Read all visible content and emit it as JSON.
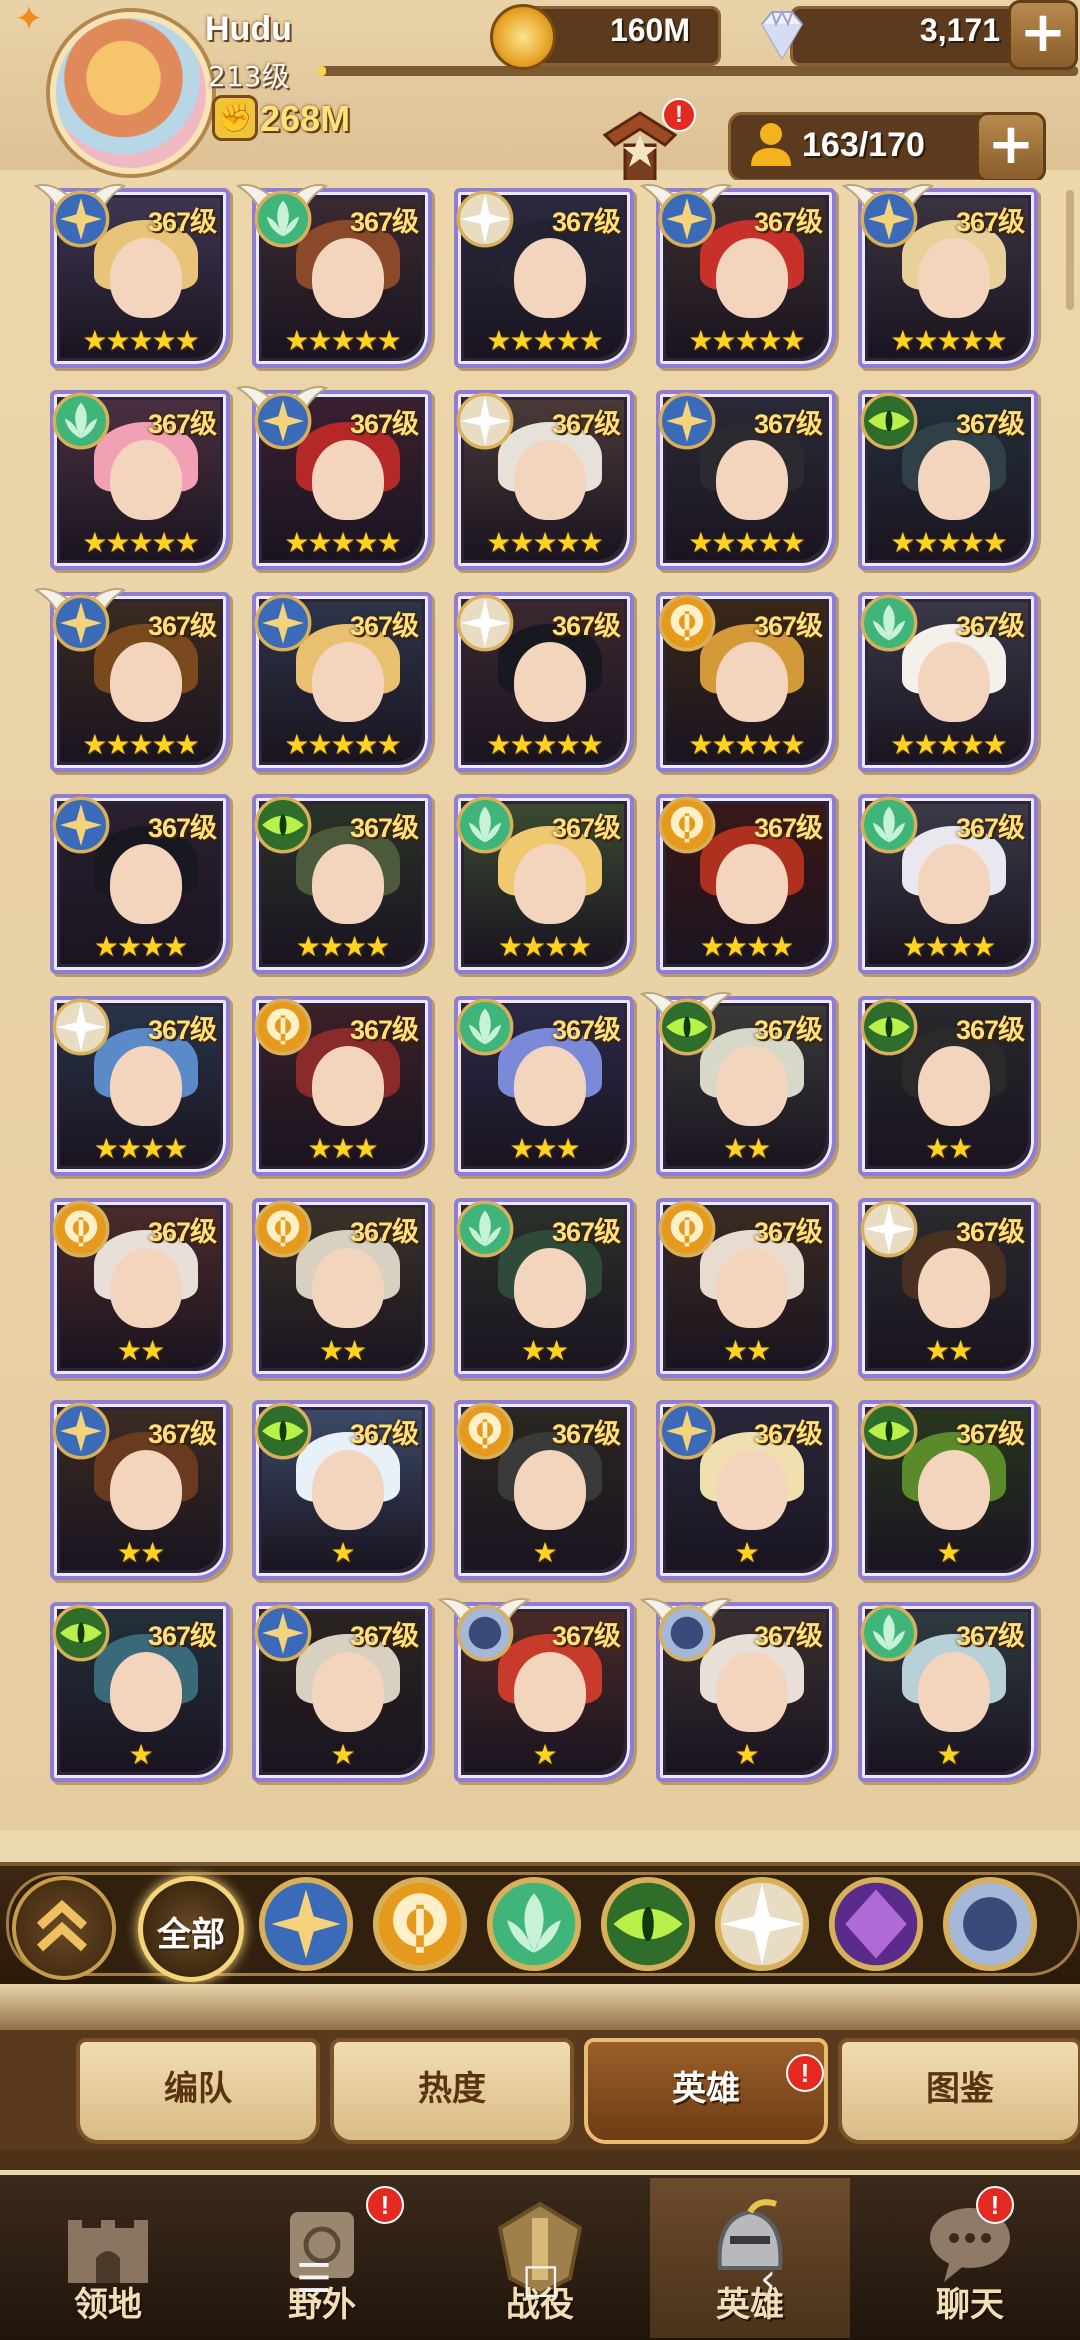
{
  "player": {
    "name": "Hudu",
    "level": "213级",
    "xp_fraction": 0.01,
    "power": "268M"
  },
  "resources": {
    "gold": "160M",
    "gems": "3,171",
    "roster": "163/170"
  },
  "heroes": [
    {
      "level": "367级",
      "stars": "★★★★★",
      "faction": "lightbearer",
      "wings": true,
      "hair": "#e8c47a",
      "bg": "#3e3550"
    },
    {
      "level": "367级",
      "stars": "★★★★★",
      "faction": "wilder",
      "wings": true,
      "hair": "#8a4a2a",
      "bg": "#3a2a30"
    },
    {
      "level": "367级",
      "stars": "★★★★★",
      "faction": "celestial",
      "wings": false,
      "hair": "#222233",
      "bg": "#2a2a3c"
    },
    {
      "level": "367级",
      "stars": "★★★★★",
      "faction": "lightbearer",
      "wings": true,
      "hair": "#c8312a",
      "bg": "#3b2e2e"
    },
    {
      "level": "367级",
      "stars": "★★★★★",
      "faction": "lightbearer",
      "wings": true,
      "hair": "#e8d09a",
      "bg": "#3a3340"
    },
    {
      "level": "367级",
      "stars": "★★★★★",
      "faction": "wilder",
      "wings": false,
      "hair": "#f2a0b4",
      "bg": "#4a3040"
    },
    {
      "level": "367级",
      "stars": "★★★★★",
      "faction": "lightbearer",
      "wings": true,
      "hair": "#b42828",
      "bg": "#3a2030"
    },
    {
      "level": "367级",
      "stars": "★★★★★",
      "faction": "celestial",
      "wings": false,
      "hair": "#e6e2da",
      "bg": "#4a3a38"
    },
    {
      "level": "367级",
      "stars": "★★★★★",
      "faction": "lightbearer",
      "wings": false,
      "hair": "#2a2a30",
      "bg": "#2a2a36"
    },
    {
      "level": "367级",
      "stars": "★★★★★",
      "faction": "graveborn",
      "wings": false,
      "hair": "#304048",
      "bg": "#22303a"
    },
    {
      "level": "367级",
      "stars": "★★★★★",
      "faction": "lightbearer",
      "wings": true,
      "hair": "#7a4a1e",
      "bg": "#3a2a20"
    },
    {
      "level": "367级",
      "stars": "★★★★★",
      "faction": "lightbearer",
      "wings": false,
      "hair": "#e8c070",
      "bg": "#2c3548"
    },
    {
      "level": "367级",
      "stars": "★★★★★",
      "faction": "celestial",
      "wings": false,
      "hair": "#181820",
      "bg": "#3a2830"
    },
    {
      "level": "367级",
      "stars": "★★★★★",
      "faction": "mauler",
      "wings": false,
      "hair": "#d49a3a",
      "bg": "#3a2818"
    },
    {
      "level": "367级",
      "stars": "★★★★★",
      "faction": "wilder",
      "wings": false,
      "hair": "#f4f0ea",
      "bg": "#3a3848"
    },
    {
      "level": "367级",
      "stars": "★★★★",
      "faction": "lightbearer",
      "wings": false,
      "hair": "#181820",
      "bg": "#2a2030"
    },
    {
      "level": "367级",
      "stars": "★★★★",
      "faction": "graveborn",
      "wings": false,
      "hair": "#4a5a3a",
      "bg": "#2a3228"
    },
    {
      "level": "367级",
      "stars": "★★★★",
      "faction": "wilder",
      "wings": false,
      "hair": "#f0c870",
      "bg": "#3a4a30"
    },
    {
      "level": "367级",
      "stars": "★★★★",
      "faction": "mauler",
      "wings": false,
      "hair": "#b03020",
      "bg": "#3a1818"
    },
    {
      "level": "367级",
      "stars": "★★★★",
      "faction": "wilder",
      "wings": false,
      "hair": "#e8e8ee",
      "bg": "#3a3a48"
    },
    {
      "level": "367级",
      "stars": "★★★★",
      "faction": "celestial",
      "wings": false,
      "hair": "#5a8ac8",
      "bg": "#283448"
    },
    {
      "level": "367级",
      "stars": "★★★",
      "faction": "mauler",
      "wings": false,
      "hair": "#8a2a2a",
      "bg": "#3a2028"
    },
    {
      "level": "367级",
      "stars": "★★★",
      "faction": "wilder",
      "wings": false,
      "hair": "#7a8ad8",
      "bg": "#2a2a48"
    },
    {
      "level": "367级",
      "stars": "★★",
      "faction": "graveborn",
      "wings": true,
      "hair": "#d8d8c8",
      "bg": "#3a3a38"
    },
    {
      "level": "367级",
      "stars": "★★",
      "faction": "graveborn",
      "wings": false,
      "hair": "#2a2a2a",
      "bg": "#28282c"
    },
    {
      "level": "367级",
      "stars": "★★",
      "faction": "mauler",
      "wings": false,
      "hair": "#e8e0d8",
      "bg": "#4a2a2a"
    },
    {
      "level": "367级",
      "stars": "★★",
      "faction": "mauler",
      "wings": false,
      "hair": "#d8d0c0",
      "bg": "#3a3228"
    },
    {
      "level": "367级",
      "stars": "★★",
      "faction": "wilder",
      "wings": false,
      "hair": "#304a3a",
      "bg": "#2a3028"
    },
    {
      "level": "367级",
      "stars": "★★",
      "faction": "mauler",
      "wings": false,
      "hair": "#e8dcd0",
      "bg": "#3a2a22"
    },
    {
      "level": "367级",
      "stars": "★★",
      "faction": "celestial",
      "wings": false,
      "hair": "#4a3020",
      "bg": "#2a2a2e"
    },
    {
      "level": "367级",
      "stars": "★★",
      "faction": "lightbearer",
      "wings": false,
      "hair": "#6a3a20",
      "bg": "#3a2a22"
    },
    {
      "level": "367级",
      "stars": "★",
      "faction": "graveborn",
      "wings": false,
      "hair": "#e8f0f8",
      "bg": "#3a4a68"
    },
    {
      "level": "367级",
      "stars": "★",
      "faction": "mauler",
      "wings": false,
      "hair": "#3a3a3a",
      "bg": "#2a2620"
    },
    {
      "level": "367级",
      "stars": "★",
      "faction": "lightbearer",
      "wings": false,
      "hair": "#f0e0b0",
      "bg": "#28283a"
    },
    {
      "level": "367级",
      "stars": "★",
      "faction": "graveborn",
      "wings": false,
      "hair": "#5a8a2a",
      "bg": "#28361e"
    },
    {
      "level": "367级",
      "stars": "★",
      "faction": "graveborn",
      "wings": false,
      "hair": "#3a6a7a",
      "bg": "#22303a"
    },
    {
      "level": "367级",
      "stars": "★",
      "faction": "lightbearer",
      "wings": false,
      "hair": "#d8d0c0",
      "bg": "#2a2420"
    },
    {
      "level": "367级",
      "stars": "★",
      "faction": "dimensional",
      "wings": true,
      "hair": "#c83a2a",
      "bg": "#4a2a28"
    },
    {
      "level": "367级",
      "stars": "★",
      "faction": "dimensional",
      "wings": true,
      "hair": "#e8e0d8",
      "bg": "#3a3030"
    },
    {
      "level": "367级",
      "stars": "★",
      "faction": "wilder",
      "wings": false,
      "hair": "#b8d0d8",
      "bg": "#2e3a40"
    }
  ],
  "faction_filters": [
    "lightbearer",
    "mauler",
    "wilder",
    "graveborn",
    "celestial",
    "hypogean",
    "dimensional"
  ],
  "faction_colors": {
    "lightbearer": "#3b6bb8",
    "mauler": "#e59a1e",
    "wilder": "#3fb57a",
    "graveborn": "#2e6e2a",
    "celestial": "#e8dcc2",
    "hypogean": "#5a2b8a",
    "dimensional": "#a6b8d8"
  },
  "filter_all_label": "全部",
  "tabs": [
    {
      "label": "编队"
    },
    {
      "label": "热度"
    },
    {
      "label": "英雄",
      "badge": "!"
    },
    {
      "label": "图鉴"
    }
  ],
  "nav": [
    {
      "label": "领地"
    },
    {
      "label": "野外",
      "badge": "!"
    },
    {
      "label": "战役"
    },
    {
      "label": "英雄"
    },
    {
      "label": "聊天",
      "badge": "!"
    }
  ],
  "alerts": {
    "shrine_badge": "!"
  },
  "system_nav": [
    "☰",
    "□",
    "‹"
  ]
}
